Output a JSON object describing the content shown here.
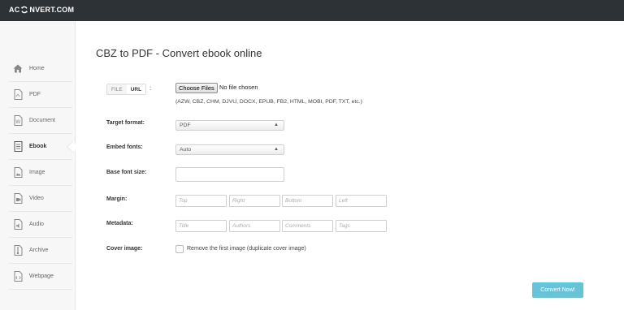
{
  "header": {
    "logo": "ACONVERT.COM",
    "logo_left": "AC",
    "logo_right": "NVERT.COM"
  },
  "sidebar": {
    "items": [
      {
        "label": "Home",
        "icon": "home-icon"
      },
      {
        "label": "PDF",
        "icon": "pdf-icon"
      },
      {
        "label": "Document",
        "icon": "document-icon"
      },
      {
        "label": "Ebook",
        "icon": "ebook-icon",
        "active": true
      },
      {
        "label": "Image",
        "icon": "image-icon"
      },
      {
        "label": "Video",
        "icon": "video-icon"
      },
      {
        "label": "Audio",
        "icon": "audio-icon"
      },
      {
        "label": "Archive",
        "icon": "archive-icon"
      },
      {
        "label": "Webpage",
        "icon": "webpage-icon"
      }
    ]
  },
  "main": {
    "title": "CBZ to PDF - Convert ebook online",
    "source_switch": {
      "file": "FILE",
      "url": "URL",
      "colon": ":"
    },
    "file_input": {
      "button": "Choose Files",
      "status": "No file chosen"
    },
    "formats_note": "(AZW, CBZ, CHM, DJVU, DOCX, EPUB, FB2, HTML, MOBI, PDF, TXT, etc.)",
    "target_format": {
      "label": "Target format:",
      "value": "PDF"
    },
    "embed_fonts": {
      "label": "Embed fonts:",
      "value": "Auto"
    },
    "base_font_size": {
      "label": "Base font size:",
      "value": ""
    },
    "margin": {
      "label": "Margin:",
      "placeholders": [
        "Top",
        "Right",
        "Bottom",
        "Left"
      ]
    },
    "metadata": {
      "label": "Metadata:",
      "placeholders": [
        "Title",
        "Authors",
        "Comments",
        "Tags"
      ]
    },
    "cover_image": {
      "label": "Cover image:",
      "checkbox_label": "Remove the first image (duplicate cover image)"
    },
    "convert_button": "Convert Now!"
  },
  "colors": {
    "topbar": "#2d3237",
    "accent": "#64c5d8",
    "sidebar_bg": "#f7f7f7"
  }
}
